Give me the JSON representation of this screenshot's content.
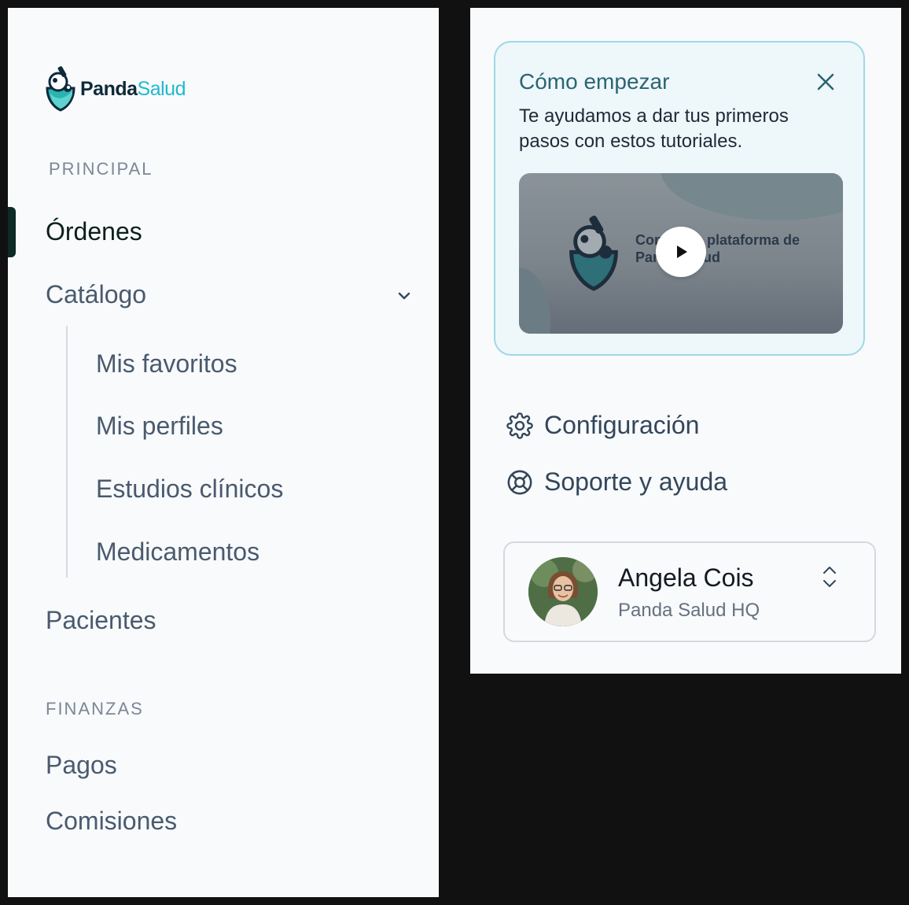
{
  "brand": {
    "name_part1": "Panda",
    "name_part2": "Salud"
  },
  "sidebar": {
    "section_principal": "PRINCIPAL",
    "items": {
      "ordenes": "Órdenes",
      "catalogo": "Catálogo",
      "pacientes": "Pacientes"
    },
    "catalogo_sub": {
      "favoritos": "Mis favoritos",
      "perfiles": "Mis perfiles",
      "estudios": "Estudios clínicos",
      "medicamentos": "Medicamentos"
    },
    "section_finanzas": "FINANZAS",
    "finanzas_items": {
      "pagos": "Pagos",
      "comisiones": "Comisiones"
    },
    "active_item": "Órdenes"
  },
  "getting_started": {
    "title": "Cómo empezar",
    "description": "Te ayudamos a dar tus primeros pasos con estos tutoriales.",
    "video_text_line1": "Conoce la plataforma de",
    "video_text_line2": "Panda Salud",
    "close_icon": "close-icon",
    "play_icon": "play-icon"
  },
  "footer_menu": {
    "settings": "Configuración",
    "support": "Soporte y ayuda"
  },
  "user": {
    "name": "Angela Cois",
    "org": "Panda Salud HQ"
  },
  "colors": {
    "accent": "#22b8cf",
    "active_bar": "#0d2a26",
    "card_bg": "#eef7fa",
    "card_border": "#9fd8e6"
  }
}
